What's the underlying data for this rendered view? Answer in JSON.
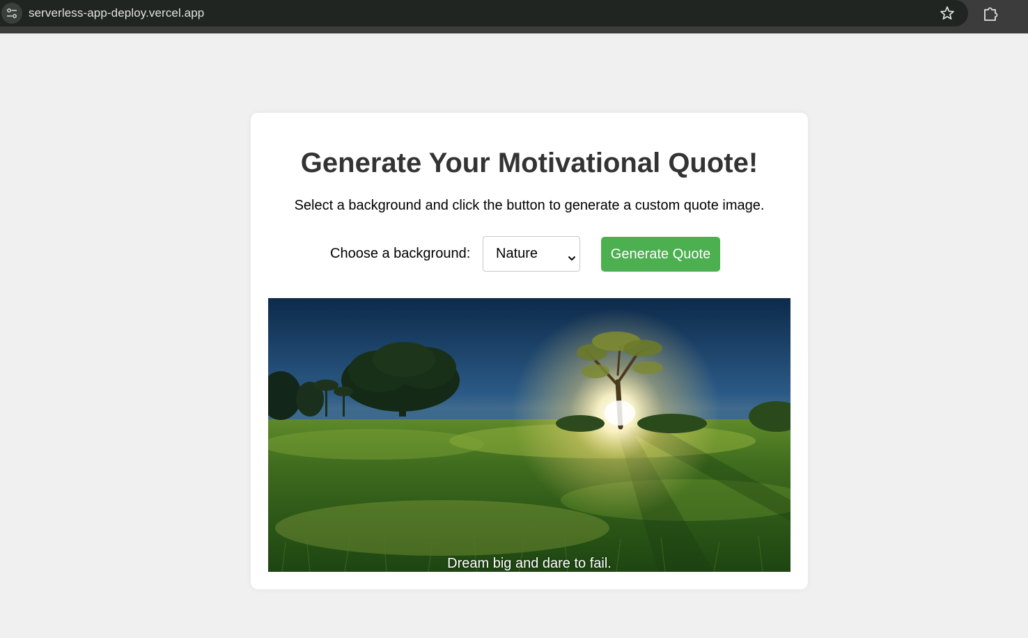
{
  "browser": {
    "url": "serverless-app-deploy.vercel.app",
    "site_info_icon": "tune-icon",
    "bookmark_icon": "star-icon",
    "extensions_icon": "puzzle-icon"
  },
  "main": {
    "title": "Generate Your Motivational Quote!",
    "subtitle": "Select a background and click the button to generate a custom quote image.",
    "background_label": "Choose a background:",
    "background_select": {
      "selected": "Nature"
    },
    "generate_button": "Generate Quote",
    "accent_color": "#4caf50"
  },
  "quote_image": {
    "quote": "Dream big and dare to fail."
  }
}
